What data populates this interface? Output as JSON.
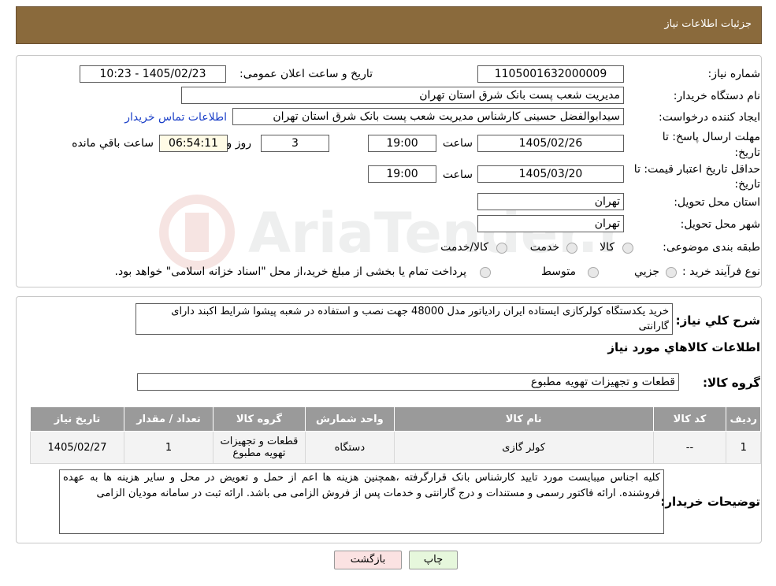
{
  "header": {
    "title": "جزئیات اطلاعات نیاز"
  },
  "form": {
    "need_number_label": "شماره نیاز:",
    "need_number": "1105001632000009",
    "announce_label": "تاریخ و ساعت اعلان عمومی:",
    "announce_value": "1405/02/23 - 10:23",
    "buyer_org_label": "نام دستگاه خریدار:",
    "buyer_org": "مدیریت شعب پست بانک شرق استان تهران",
    "creator_label": "ایجاد کننده درخواست:",
    "creator": "سیدابوالفضل حسینی کارشناس مدیریت شعب پست بانک شرق استان تهران",
    "contact_link": "اطلاعات تماس خریدار",
    "deadline_label": "مهلت ارسال پاسخ: تا تاریخ:",
    "deadline_date": "1405/02/26",
    "time_label": "ساعت",
    "deadline_time": "19:00",
    "days_value": "3",
    "days_label": "روز و",
    "remaining_time": "06:54:11",
    "remaining_label": "ساعت باقي مانده",
    "price_validity_label": "حداقل تاریخ اعتبار قیمت: تا تاریخ:",
    "price_validity_date": "1405/03/20",
    "price_validity_time": "19:00",
    "province_label": "استان محل تحویل:",
    "province": "تهران",
    "city_label": "شهر محل تحویل:",
    "city": "تهران",
    "category_label": "طبقه بندی موضوعی:",
    "category_options": [
      "کالا",
      "خدمت",
      "کالا/خدمت"
    ],
    "process_label": "نوع فرآیند خرید :",
    "process_options": [
      "جزیي",
      "متوسط"
    ],
    "process_note": "پرداخت تمام یا بخشی از مبلغ خرید،از محل \"اسناد خزانه اسلامی\" خواهد بود."
  },
  "description": {
    "label": "شرح کلي نياز:",
    "text": "خرید یکدستگاه کولرکازی ایستاده  ایران رادیاتور مدل 48000 جهت نصب و  استفاده در شعبه پیشوا شرایط اکبند دارای گارانتی"
  },
  "goods": {
    "section_title": "اطلاعات کالاهاي مورد نياز",
    "group_label": "گروه کالا:",
    "group_value": "قطعات و تجهیزات تهویه مطبوع"
  },
  "table": {
    "headers": [
      "ردیف",
      "کد کالا",
      "نام کالا",
      "واحد شمارش",
      "گروه کالا",
      "تعداد / مقدار",
      "تاریخ نیاز"
    ],
    "rows": [
      [
        "1",
        "--",
        "کولر گازی",
        "دستگاه",
        "قطعات و تجهیزات تهویه مطبوع",
        "1",
        "1405/02/27"
      ]
    ]
  },
  "buyer_notes": {
    "label": "توضیحات خریدار:",
    "text": "کلیه اجناس میبایست مورد تایید کارشناس بانک قرارگرفته ،همچنین هزینه ها اعم از حمل و تعویض در محل  و سایر هزینه ها به عهده فروشنده. ارائه فاکتور رسمی و مستندات و درج گارانتی و خدمات پس از فروش الزامی می باشد. ارائه ثبت در سامانه مودیان الزامی"
  },
  "buttons": {
    "print": "چاپ",
    "back": "بازگشت"
  },
  "watermark": {
    "text": "AriaTender.neT"
  },
  "colors": {
    "header_bg": "#8a6a3c",
    "link": "#1a3fc8",
    "table_header": "#9a9a9a",
    "print_btn": "#e6f7dc",
    "back_btn": "#fbe2e2"
  }
}
